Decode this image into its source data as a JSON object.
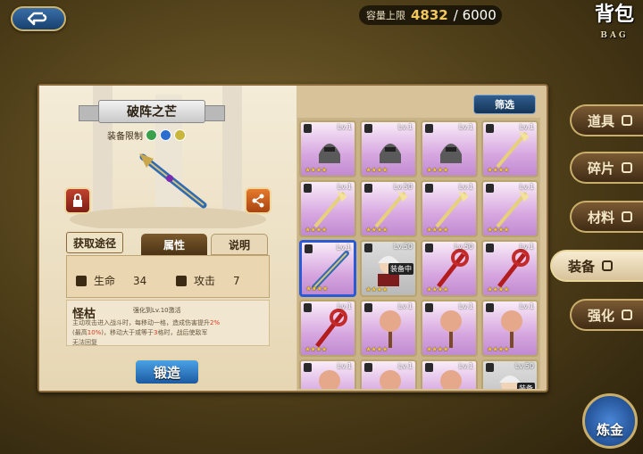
{
  "header": {
    "capacity_label": "容量上限",
    "capacity_current": "4832",
    "capacity_max": "/ 6000",
    "title": "背包",
    "title_en": "BAG"
  },
  "detail": {
    "item_name": "破阵之芒",
    "equip_limit_label": "装备限制",
    "tabs": {
      "source": "获取途径",
      "attributes": "属性",
      "description": "说明"
    },
    "stats": {
      "hp_label": "生命",
      "hp_value": "34",
      "atk_label": "攻击",
      "atk_value": "7"
    },
    "skill": {
      "name": "怪枯",
      "note": "强化到Lv.10激活",
      "line1_a": "主动攻击进入战斗时，每移动一格，造成伤害提升",
      "line1_hl": "2%",
      "line2_a": "(最高",
      "line2_hl1": "10%",
      "line2_b": ")，移动大于或等于",
      "line2_hl2": "3",
      "line2_c": "格时，战后使敌军",
      "line3": "无法回复"
    },
    "forge_button": "锻造"
  },
  "filter_button": "筛选",
  "side_tabs": [
    "道具",
    "碎片",
    "材料",
    "装备",
    "强化"
  ],
  "active_side_tab": "装备",
  "alchemy_button": "炼金",
  "grid": {
    "cells": [
      {
        "lv": "Lv.1",
        "kind": "helmet",
        "equipped": false
      },
      {
        "lv": "Lv.1",
        "kind": "helmet",
        "equipped": false
      },
      {
        "lv": "Lv.1",
        "kind": "helmet",
        "equipped": false
      },
      {
        "lv": "Lv.1",
        "kind": "staff",
        "equipped": false
      },
      {
        "lv": "Lv.1",
        "kind": "staff",
        "equipped": false
      },
      {
        "lv": "Lv.50",
        "kind": "staff",
        "equipped": false
      },
      {
        "lv": "Lv.1",
        "kind": "staff",
        "equipped": false
      },
      {
        "lv": "Lv.1",
        "kind": "staff",
        "equipped": false
      },
      {
        "lv": "Lv.1",
        "kind": "lance",
        "equipped": false,
        "selected": true
      },
      {
        "lv": "Lv.50",
        "kind": "char",
        "equipped": true
      },
      {
        "lv": "Lv.50",
        "kind": "crimson",
        "equipped": false
      },
      {
        "lv": "Lv.1",
        "kind": "crimson",
        "equipped": false
      },
      {
        "lv": "Lv.1",
        "kind": "crimson",
        "equipped": false
      },
      {
        "lv": "Lv.1",
        "kind": "mace",
        "equipped": false
      },
      {
        "lv": "Lv.1",
        "kind": "mace",
        "equipped": false
      },
      {
        "lv": "Lv.1",
        "kind": "mace",
        "equipped": false
      },
      {
        "lv": "Lv.1",
        "kind": "mace",
        "equipped": false
      },
      {
        "lv": "Lv.1",
        "kind": "mace",
        "equipped": false
      },
      {
        "lv": "Lv.1",
        "kind": "mace",
        "equipped": false
      },
      {
        "lv": "Lv.50",
        "kind": "char",
        "equipped": true
      }
    ],
    "equipped_label": "装备中",
    "equipped_label_short": "装备"
  }
}
